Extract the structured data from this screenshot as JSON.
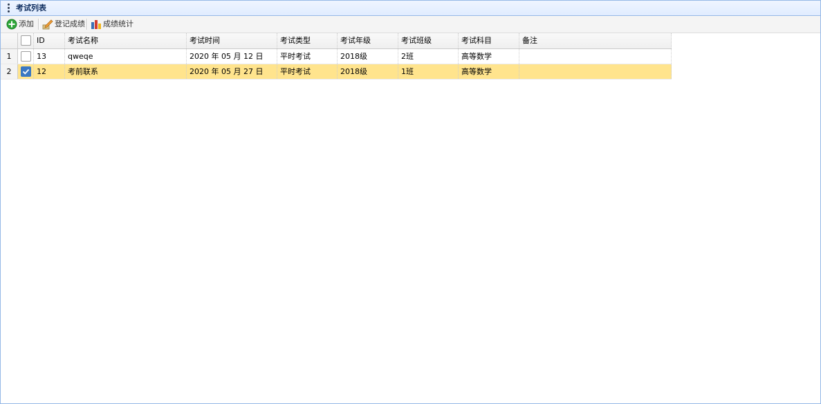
{
  "panel": {
    "title": "考试列表"
  },
  "toolbar": {
    "add_label": "添加",
    "register_label": "登记成绩",
    "stats_label": "成绩统计"
  },
  "table": {
    "columns": [
      "ID",
      "考试名称",
      "考试时间",
      "考试类型",
      "考试年级",
      "考试班级",
      "考试科目",
      "备注"
    ],
    "rows": [
      {
        "num": "1",
        "checked": false,
        "id": "13",
        "name": "qweqe",
        "time": "2020 年 05 月 12 日",
        "type": "平时考试",
        "grade": "2018级",
        "class": "2班",
        "subject": "高等数学",
        "note": ""
      },
      {
        "num": "2",
        "checked": true,
        "id": "12",
        "name": "考前联系",
        "time": "2020 年 05 月 27 日",
        "type": "平时考试",
        "grade": "2018级",
        "class": "1班",
        "subject": "高等数学",
        "note": ""
      }
    ]
  },
  "colors": {
    "border": "#95b8e7",
    "selected_row": "#ffe48d",
    "checkbox_checked": "#3a78c3"
  }
}
